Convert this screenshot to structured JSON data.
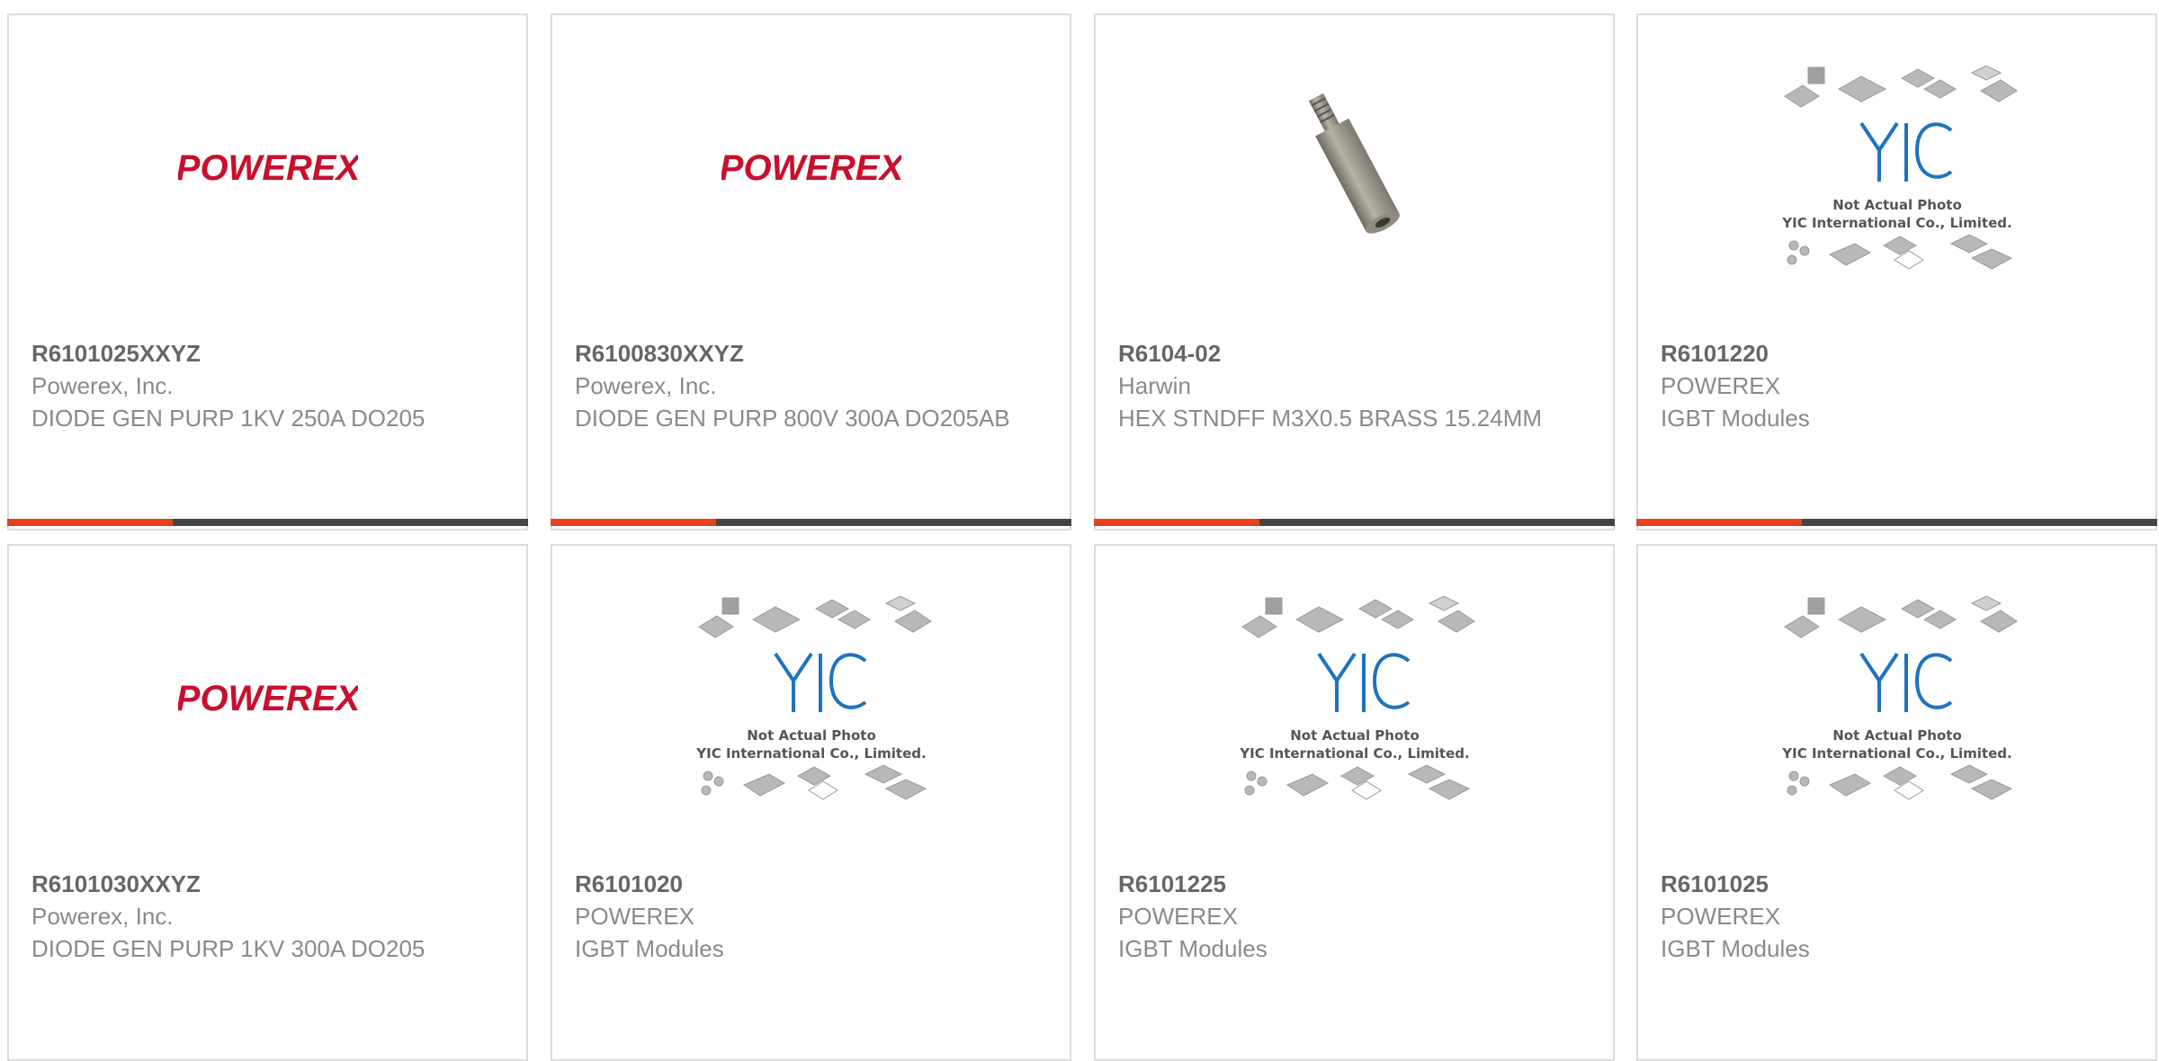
{
  "products": [
    {
      "part_number": "R6101025XXYZ",
      "manufacturer": "Powerex, Inc.",
      "description": "DIODE GEN PURP 1KV 250A DO205",
      "image": "powerex-logo"
    },
    {
      "part_number": "R6100830XXYZ",
      "manufacturer": "Powerex, Inc.",
      "description": "DIODE GEN PURP 800V 300A DO205AB",
      "image": "powerex-logo"
    },
    {
      "part_number": "R6104-02",
      "manufacturer": "Harwin",
      "description": "HEX STNDFF M3X0.5 BRASS 15.24MM",
      "image": "standoff-photo"
    },
    {
      "part_number": "R6101220",
      "manufacturer": "POWEREX",
      "description": "IGBT Modules",
      "image": "not-actual-photo"
    },
    {
      "part_number": "R6101030XXYZ",
      "manufacturer": "Powerex, Inc.",
      "description": "DIODE GEN PURP 1KV 300A DO205",
      "image": "powerex-logo"
    },
    {
      "part_number": "R6101020",
      "manufacturer": "POWEREX",
      "description": "IGBT Modules",
      "image": "not-actual-photo"
    },
    {
      "part_number": "R6101225",
      "manufacturer": "POWEREX",
      "description": "IGBT Modules",
      "image": "not-actual-photo"
    },
    {
      "part_number": "R6101025",
      "manufacturer": "POWEREX",
      "description": "IGBT Modules",
      "image": "not-actual-photo"
    }
  ],
  "logo_text": "POWEREX",
  "placeholder": {
    "brand": "YIC",
    "line1": "Not Actual Photo",
    "line2": "YIC International Co., Limited."
  },
  "colors": {
    "accent": "#e8401c",
    "bar": "#444444",
    "logo": "#c8102e",
    "yic_blue": "#1e73be"
  }
}
